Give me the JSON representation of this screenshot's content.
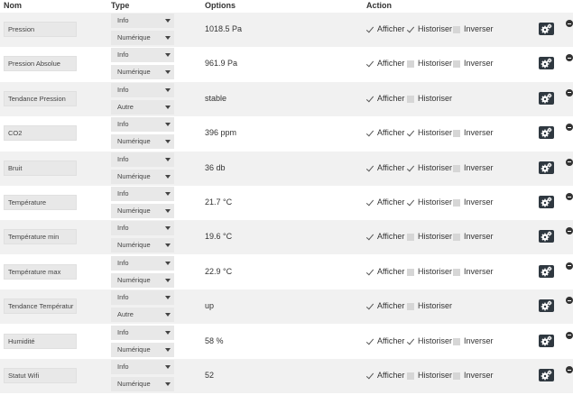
{
  "header": {
    "nom": "Nom",
    "type": "Type",
    "options": "Options",
    "action": "Action"
  },
  "labels": {
    "afficher": "Afficher",
    "historiser": "Historiser",
    "inverser": "Inverser"
  },
  "rows": [
    {
      "name": "Pression",
      "type": "Info",
      "subtype": "Numérique",
      "value": "1018.5 Pa",
      "afficher": true,
      "historiser": true,
      "inverser": false,
      "show_inverser": true
    },
    {
      "name": "Pression Absolue",
      "type": "Info",
      "subtype": "Numérique",
      "value": "961.9 Pa",
      "afficher": true,
      "historiser": false,
      "inverser": false,
      "show_inverser": true
    },
    {
      "name": "Tendance Pression",
      "type": "Info",
      "subtype": "Autre",
      "value": "stable",
      "afficher": true,
      "historiser": false,
      "inverser": false,
      "show_inverser": false
    },
    {
      "name": "CO2",
      "type": "Info",
      "subtype": "Numérique",
      "value": "396 ppm",
      "afficher": true,
      "historiser": true,
      "inverser": false,
      "show_inverser": true
    },
    {
      "name": "Bruit",
      "type": "Info",
      "subtype": "Numérique",
      "value": "36 db",
      "afficher": true,
      "historiser": true,
      "inverser": false,
      "show_inverser": true
    },
    {
      "name": "Température",
      "type": "Info",
      "subtype": "Numérique",
      "value": "21.7 °C",
      "afficher": true,
      "historiser": true,
      "inverser": false,
      "show_inverser": true
    },
    {
      "name": "Température min",
      "type": "Info",
      "subtype": "Numérique",
      "value": "19.6 °C",
      "afficher": true,
      "historiser": false,
      "inverser": false,
      "show_inverser": true
    },
    {
      "name": "Température max",
      "type": "Info",
      "subtype": "Numérique",
      "value": "22.9 °C",
      "afficher": true,
      "historiser": false,
      "inverser": false,
      "show_inverser": true
    },
    {
      "name": "Tendance Températur",
      "type": "Info",
      "subtype": "Autre",
      "value": "up",
      "afficher": true,
      "historiser": false,
      "inverser": false,
      "show_inverser": false
    },
    {
      "name": "Humidité",
      "type": "Info",
      "subtype": "Numérique",
      "value": "58 %",
      "afficher": true,
      "historiser": true,
      "inverser": false,
      "show_inverser": true
    },
    {
      "name": "Statut Wifi",
      "type": "Info",
      "subtype": "Numérique",
      "value": "52",
      "afficher": true,
      "historiser": false,
      "inverser": false,
      "show_inverser": true
    }
  ],
  "icons": {
    "configure": "cogs-icon",
    "remove": "minus-circle-icon"
  }
}
